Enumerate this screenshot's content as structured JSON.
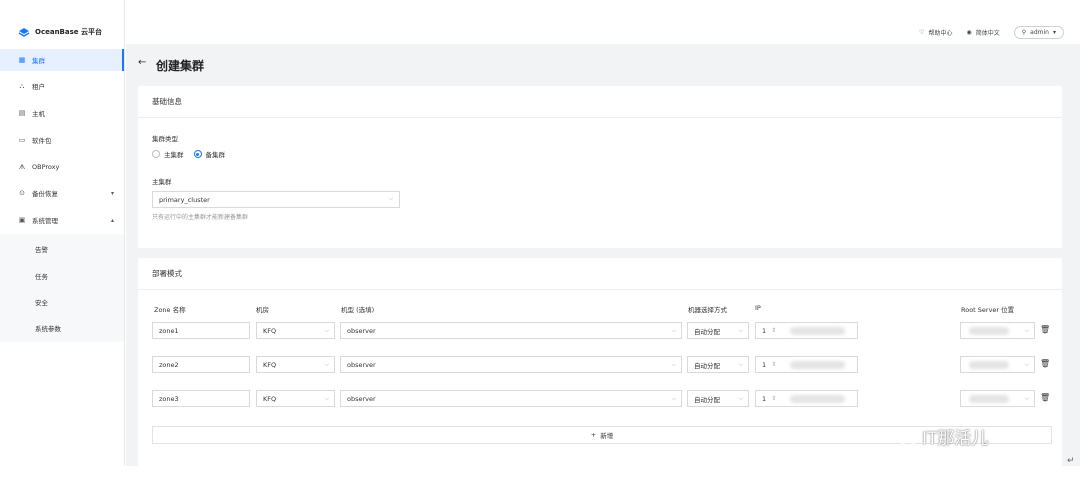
{
  "app": {
    "logo_text": "OceanBase 云平台"
  },
  "sidebar": {
    "items": [
      {
        "label": "集群",
        "icon": "grid-icon"
      },
      {
        "label": "租户",
        "icon": "tenant-icon"
      },
      {
        "label": "主机",
        "icon": "host-icon"
      },
      {
        "label": "软件包",
        "icon": "folder-icon"
      },
      {
        "label": "OBProxy",
        "icon": "proxy-icon"
      },
      {
        "label": "备份恢复",
        "icon": "backup-icon"
      },
      {
        "label": "系统管理",
        "icon": "system-icon"
      }
    ],
    "sub_items": [
      "告警",
      "任务",
      "安全",
      "系统参数"
    ]
  },
  "topbar": {
    "help": "帮助中心",
    "language": "简体中文",
    "user": "admin"
  },
  "page": {
    "title": "创建集群"
  },
  "basic": {
    "section_title": "基础信息",
    "cluster_type_label": "集群类型",
    "radio_primary": "主集群",
    "radio_standby": "备集群",
    "primary_label": "主集群",
    "primary_value": "primary_cluster",
    "hint": "只有运行中的主集群才能新建备集群"
  },
  "deploy": {
    "section_title": "部署模式",
    "columns": {
      "zone": "Zone 名称",
      "idc": "机房",
      "type": "机型 (选填)",
      "select_mode": "机器选择方式",
      "ip": "IP",
      "root": "Root Server 位置"
    },
    "rows": [
      {
        "zone": "zone1",
        "idc": "KFQ",
        "type": "observer",
        "mode": "自动分配",
        "count": "1"
      },
      {
        "zone": "zone2",
        "idc": "KFQ",
        "type": "observer",
        "mode": "自动分配",
        "count": "1"
      },
      {
        "zone": "zone3",
        "idc": "KFQ",
        "type": "observer",
        "mode": "自动分配",
        "count": "1"
      }
    ],
    "add_label": "新增"
  },
  "watermark": {
    "text": "IT那活儿"
  }
}
